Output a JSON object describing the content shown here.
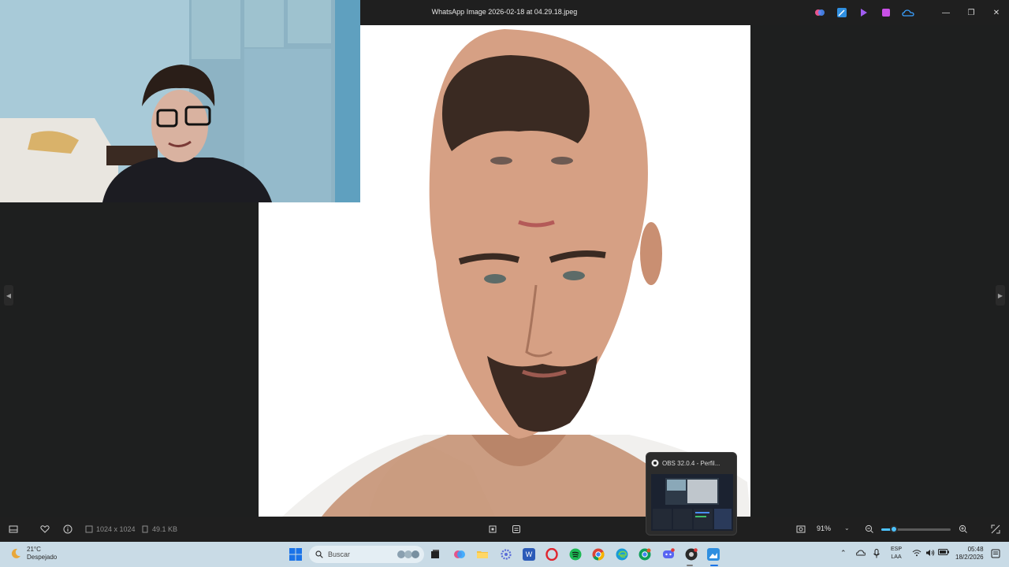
{
  "window": {
    "title": "WhatsApp Image 2026-02-18 at 04.29.18.jpeg",
    "title_apps": [
      "copilot-icon",
      "photos-edit-icon",
      "clipchamp-icon",
      "designer-icon",
      "onedrive-icon"
    ],
    "controls": {
      "minimize": "—",
      "restore": "❐",
      "close": "✕"
    }
  },
  "viewer": {
    "prev": "◀",
    "next": "▶"
  },
  "toolbar": {
    "dimensions": "1024 x 1024",
    "file_size": "49.1 KB",
    "zoom_percent": "91%",
    "zoom_level": 0.18
  },
  "obs_thumbnail": {
    "title": "OBS 32.0.4 - Perfil..."
  },
  "taskbar": {
    "weather_temp": "21°C",
    "weather_desc": "Despejado",
    "search_placeholder": "Buscar",
    "language_line1": "ESP",
    "language_line2": "LAA",
    "time": "05:48",
    "date": "18/2/2026"
  },
  "colors": {
    "accent": "#4cc2ff",
    "viewer_bg": "#1e1f1f",
    "taskbar_bg": "#c9dbe6"
  }
}
